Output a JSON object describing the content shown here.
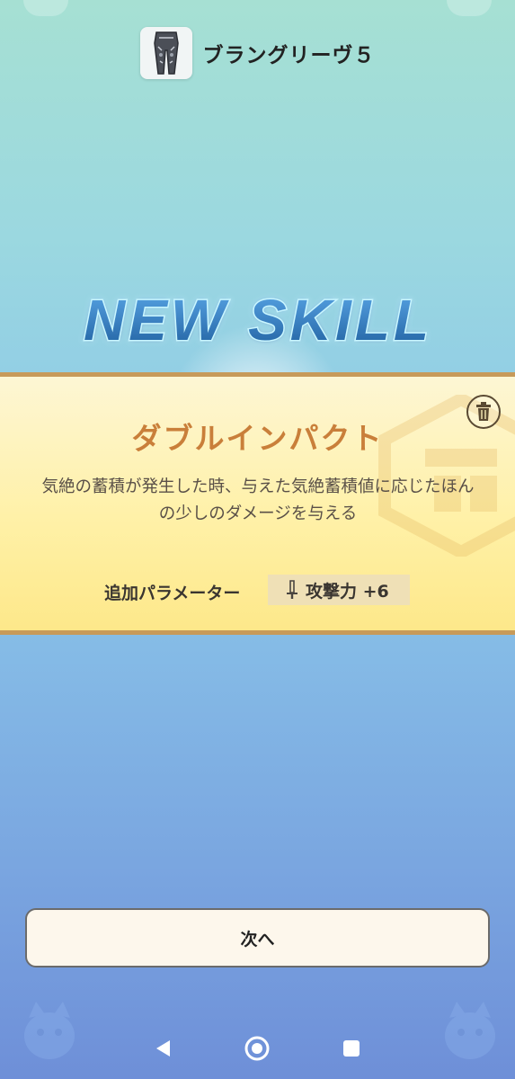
{
  "header": {
    "item_name": "ブラングリーヴ５",
    "thumb_icon": "armor-legs-icon"
  },
  "banner": {
    "title": "NEW SKILL"
  },
  "skill": {
    "name": "ダブルインパクト",
    "description_line1": "気絶の蓄積が発生した時、与えた気絶蓄積値に応じたほん",
    "description_line2": "の少しのダメージを与える",
    "param_label": "追加パラメーター",
    "param_icon": "sword-icon",
    "param_value": "攻撃力 +6",
    "trash_icon": "trash-icon"
  },
  "actions": {
    "next_label": "次へ"
  },
  "colors": {
    "skill_name": "#c97f3a",
    "panel_border": "#c79a5a",
    "title_fill": "#2b6fb3",
    "title_glow": "#bff4ff"
  },
  "nav": {
    "back_icon": "back-triangle-icon",
    "home_icon": "home-circle-icon",
    "recents_icon": "recents-square-icon"
  }
}
